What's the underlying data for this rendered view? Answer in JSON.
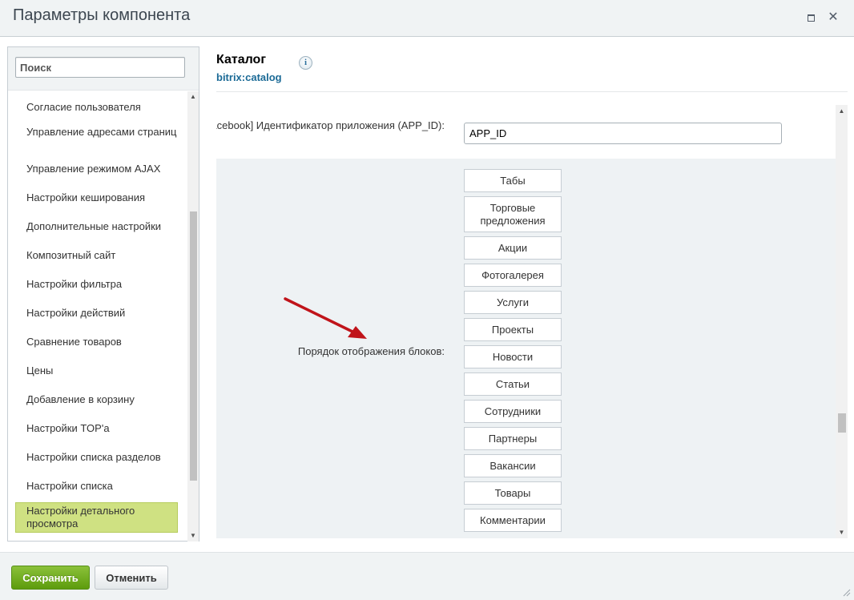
{
  "window": {
    "title": "Параметры компонента",
    "maximize_icon": "maximize-icon",
    "close_icon": "close-icon",
    "close_glyph": "✕"
  },
  "sidebar": {
    "search_placeholder": "Поиск",
    "items": [
      {
        "label": "Согласие пользователя"
      },
      {
        "label": "Управление адресами страниц"
      },
      {
        "label": "Управление режимом AJAX"
      },
      {
        "label": "Настройки кеширования"
      },
      {
        "label": "Дополнительные настройки"
      },
      {
        "label": "Композитный сайт"
      },
      {
        "label": "Настройки фильтра"
      },
      {
        "label": "Настройки действий"
      },
      {
        "label": "Сравнение товаров"
      },
      {
        "label": "Цены"
      },
      {
        "label": "Добавление в корзину"
      },
      {
        "label": "Настройки TOP'a"
      },
      {
        "label": "Настройки списка разделов"
      },
      {
        "label": "Настройки списка"
      },
      {
        "label": "Настройки детального просмотра",
        "active": true
      }
    ],
    "active_color": "#cfe182"
  },
  "component": {
    "title": "Каталог",
    "code": "bitrix:catalog",
    "info_glyph": "i"
  },
  "params": {
    "facebook_label": "[facebook] Идентификатор приложения (APP_ID):",
    "facebook_value": "APP_ID",
    "order_label": "Порядок отображения блоков:",
    "blocks": [
      {
        "label": "Табы"
      },
      {
        "label": "Торговые предложения"
      },
      {
        "label": "Акции"
      },
      {
        "label": "Фотогалерея"
      },
      {
        "label": "Услуги"
      },
      {
        "label": "Проекты"
      },
      {
        "label": "Новости"
      },
      {
        "label": "Статьи"
      },
      {
        "label": "Сотрудники"
      },
      {
        "label": "Партнеры"
      },
      {
        "label": "Вакансии"
      },
      {
        "label": "Товары"
      },
      {
        "label": "Комментарии"
      }
    ]
  },
  "footer": {
    "save_label": "Сохранить",
    "cancel_label": "Отменить",
    "save_color": "#6aa716"
  },
  "annotation": {
    "arrow_color": "#c0141a"
  }
}
